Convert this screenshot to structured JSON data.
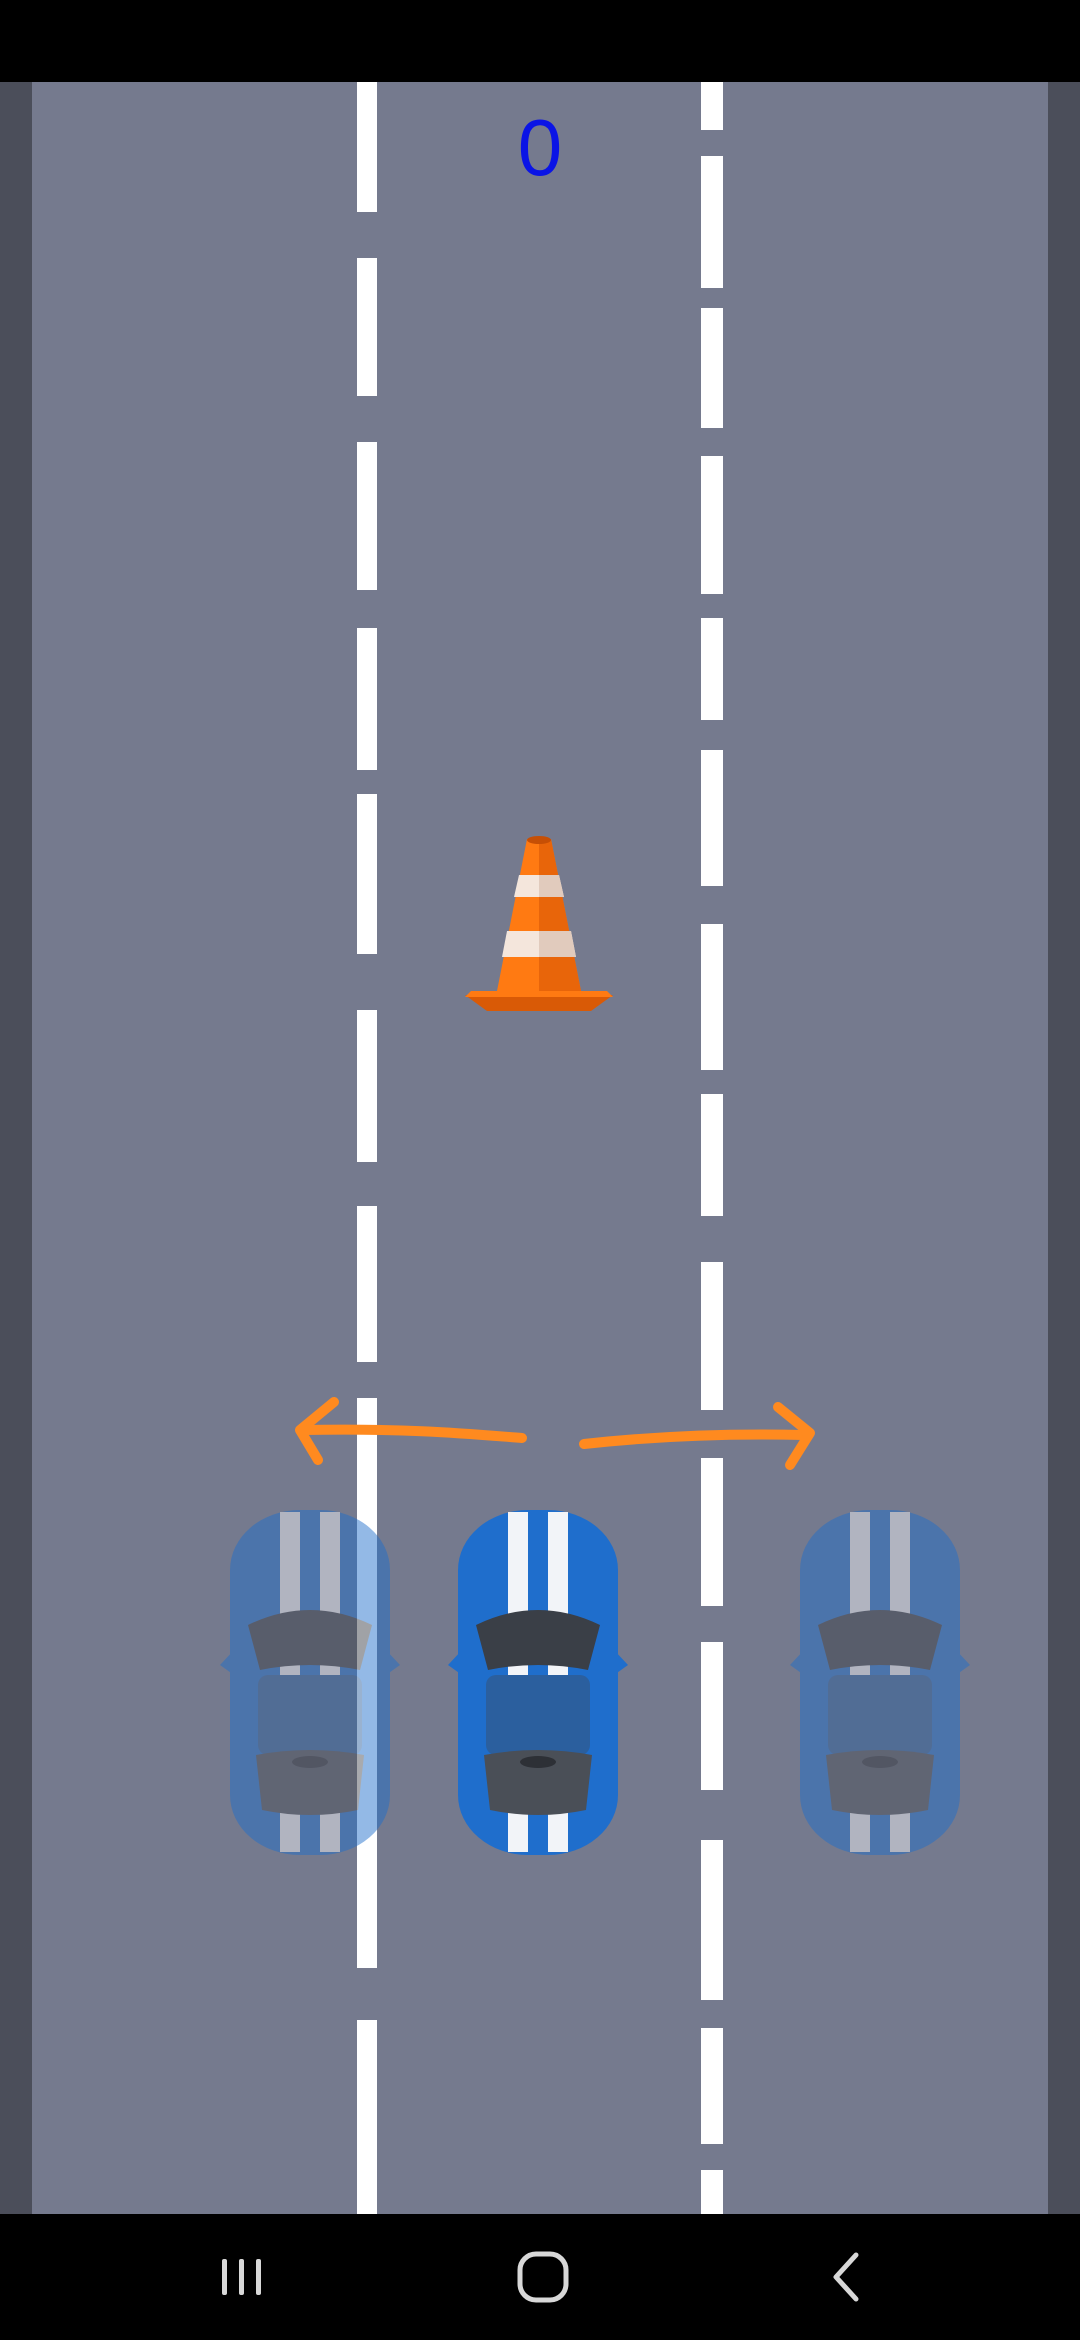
{
  "game": {
    "score": "0",
    "colors": {
      "road": "#757a8e",
      "shoulder": "#4b4e5a",
      "lane_marking": "#ffffff",
      "score_text": "#0a14e6",
      "arrow": "#ff8a1f",
      "car_body": "#1f6ecc",
      "cone": "#ff7a12"
    },
    "obstacle": {
      "type": "traffic-cone-icon"
    },
    "player_car": {
      "type": "sports-car-icon",
      "lane": "center"
    },
    "lane_hints": [
      {
        "lane": "left",
        "icon": "sports-car-icon"
      },
      {
        "lane": "right",
        "icon": "sports-car-icon"
      }
    ],
    "swipe_hints": [
      "arrow-left-icon",
      "arrow-right-icon"
    ]
  },
  "navigation": {
    "buttons": [
      {
        "name": "recent-apps",
        "icon": "recent-apps-icon"
      },
      {
        "name": "home",
        "icon": "home-icon"
      },
      {
        "name": "back",
        "icon": "back-icon"
      }
    ]
  }
}
